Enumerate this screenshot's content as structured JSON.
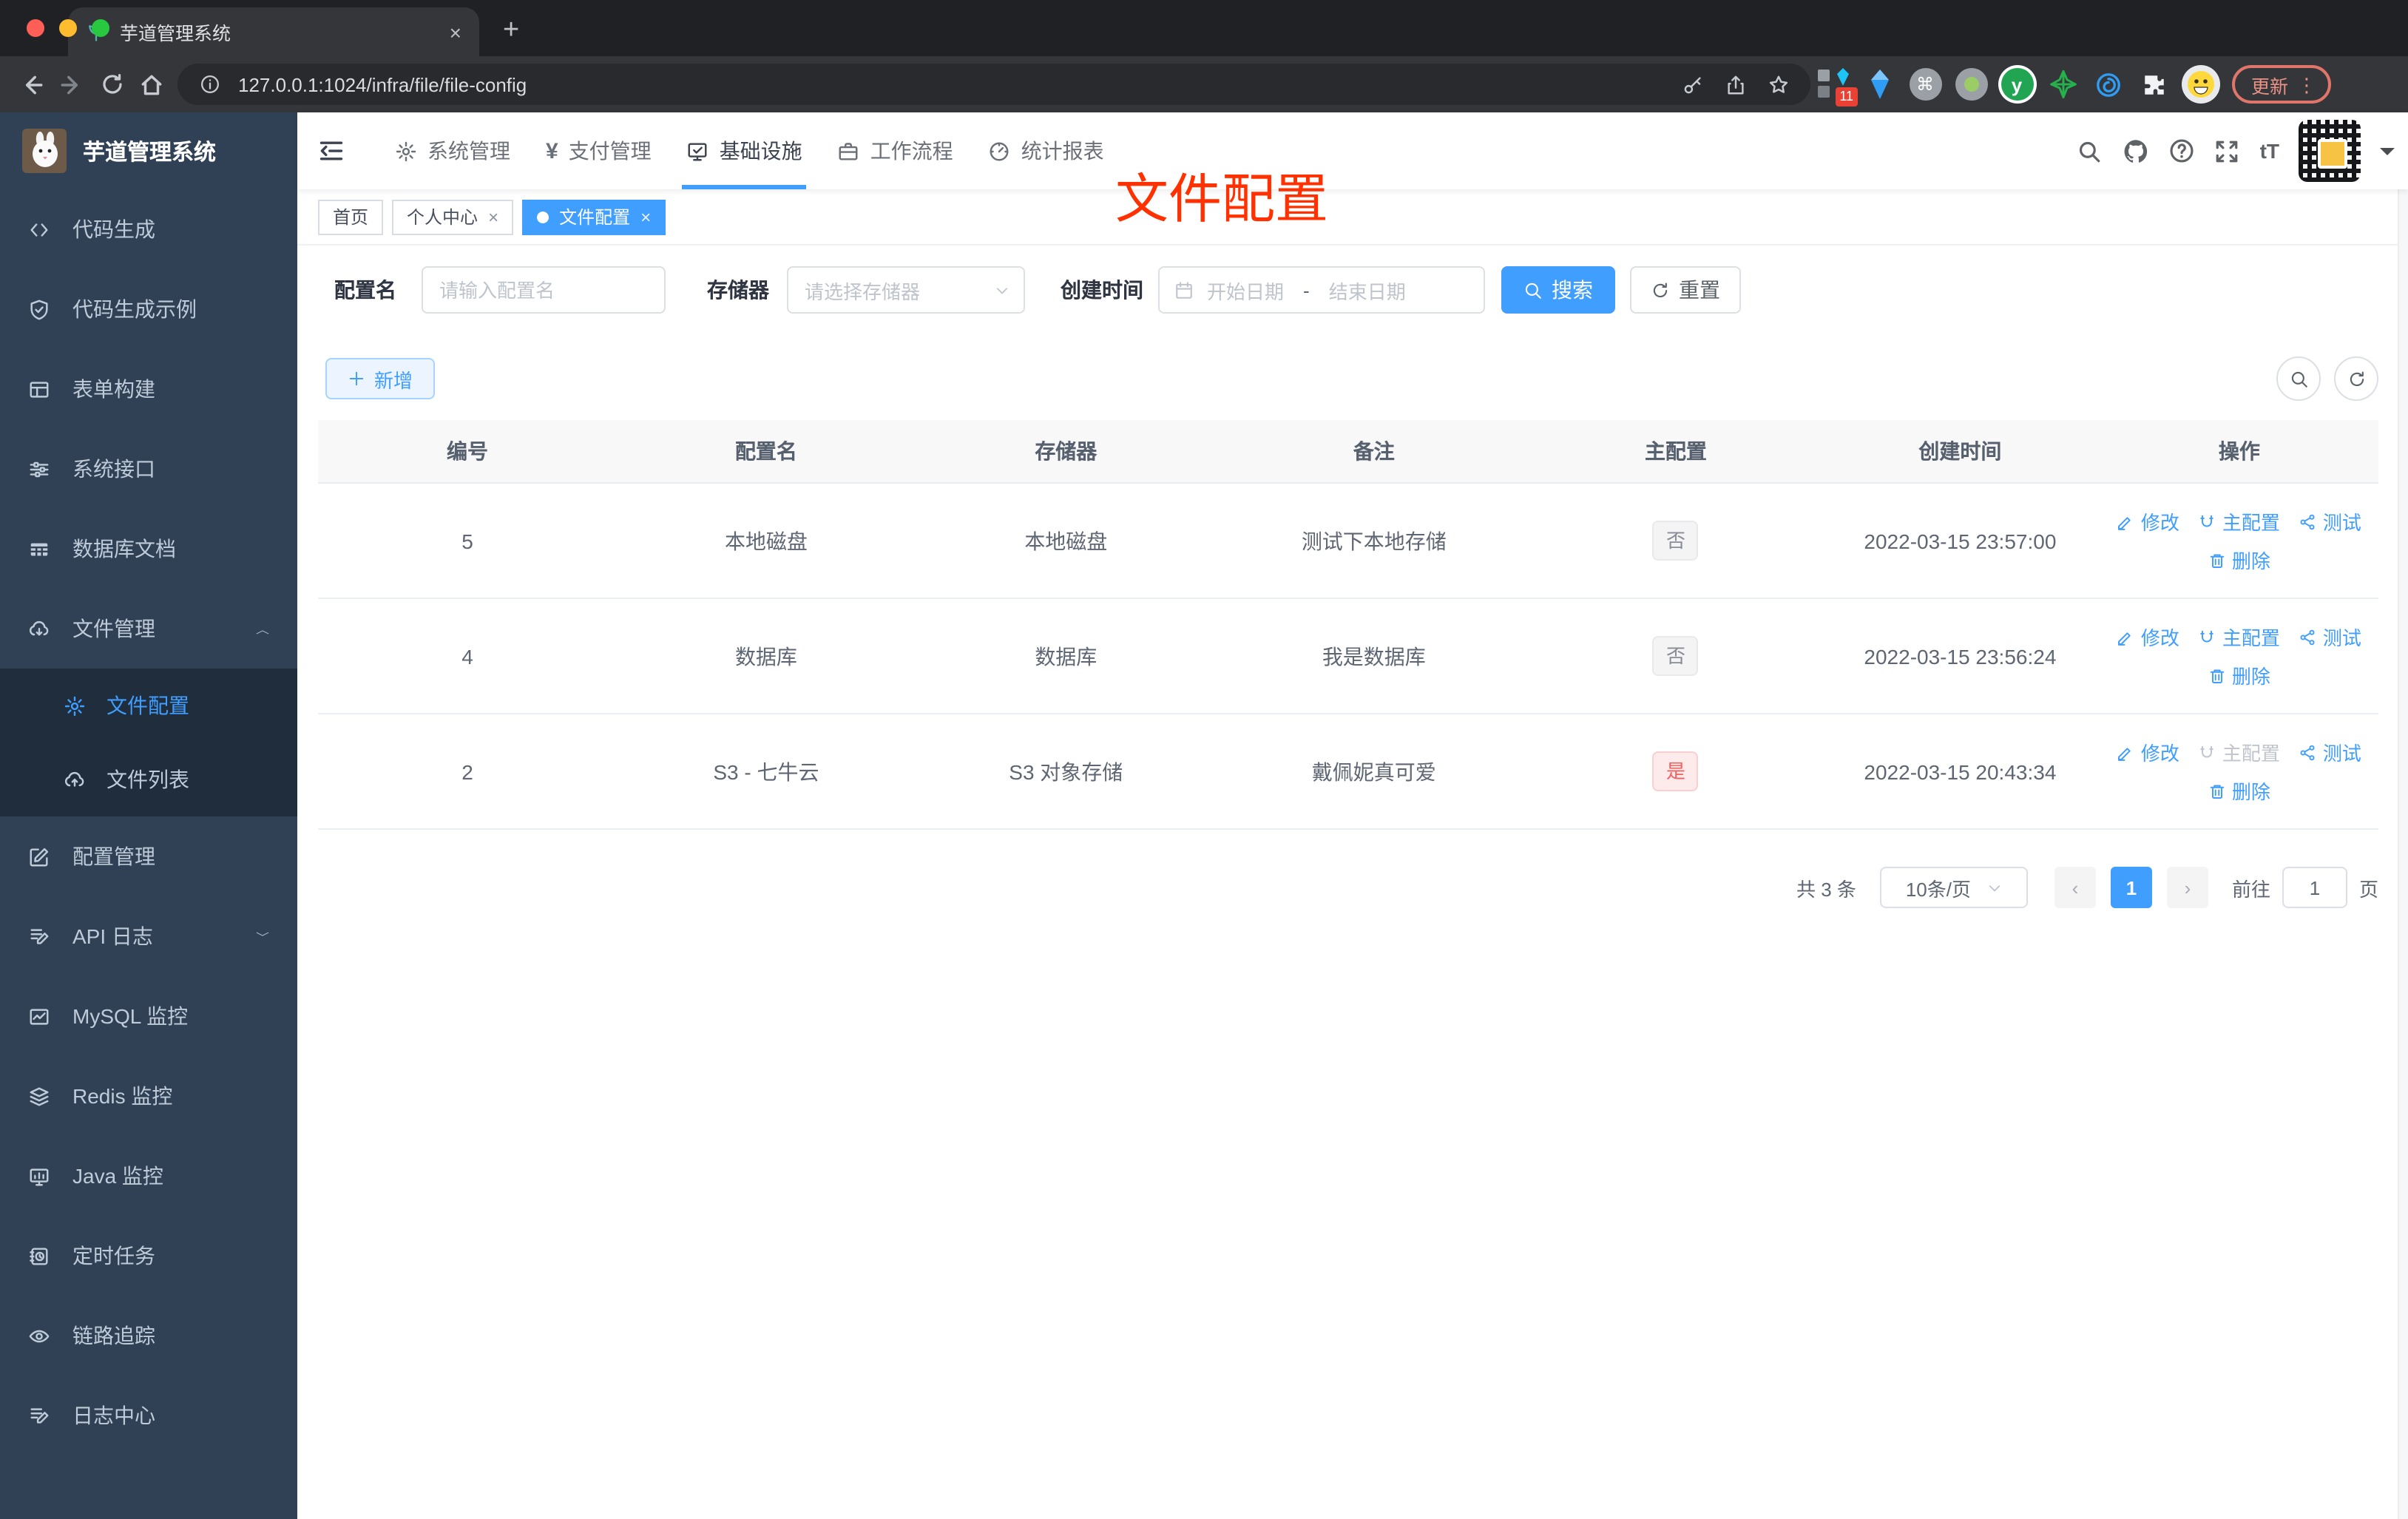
{
  "browser": {
    "tab_title": "芋道管理系统",
    "tab_close": "×",
    "new_tab": "+",
    "url": "127.0.0.1:1024/infra/file/file-config",
    "extension_badge": "11",
    "cmd_glyph": "⌘",
    "y_glyph": "y",
    "update_label": "更新",
    "menu_dots": "⋮"
  },
  "sidebar": {
    "title": "芋道管理系统",
    "items": [
      {
        "label": "代码生成"
      },
      {
        "label": "代码生成示例"
      },
      {
        "label": "表单构建"
      },
      {
        "label": "系统接口"
      },
      {
        "label": "数据库文档"
      },
      {
        "label": "文件管理"
      },
      {
        "label": "文件配置"
      },
      {
        "label": "文件列表"
      },
      {
        "label": "配置管理"
      },
      {
        "label": "API 日志"
      },
      {
        "label": "MySQL 监控"
      },
      {
        "label": "Redis 监控"
      },
      {
        "label": "Java 监控"
      },
      {
        "label": "定时任务"
      },
      {
        "label": "链路追踪"
      },
      {
        "label": "日志中心"
      }
    ]
  },
  "topnav": {
    "yen_glyph": "¥",
    "font_size_glyph": "tT",
    "items": [
      {
        "label": "系统管理"
      },
      {
        "label": "支付管理"
      },
      {
        "label": "基础设施"
      },
      {
        "label": "工作流程"
      },
      {
        "label": "统计报表"
      }
    ]
  },
  "tags": {
    "items": [
      {
        "label": "首页"
      },
      {
        "label": "个人中心"
      },
      {
        "label": "文件配置"
      }
    ],
    "close_glyph": "×"
  },
  "annotation": {
    "text": "文件配置"
  },
  "filters": {
    "config_name_label": "配置名",
    "config_name_placeholder": "请输入配置名",
    "storage_label": "存储器",
    "storage_placeholder": "请选择存储器",
    "create_time_label": "创建时间",
    "date_start_placeholder": "开始日期",
    "date_separator": "-",
    "date_end_placeholder": "结束日期",
    "search_label": "搜索",
    "reset_label": "重置"
  },
  "toolbar": {
    "add_label": "新增"
  },
  "table": {
    "columns": [
      "编号",
      "配置名",
      "存储器",
      "备注",
      "主配置",
      "创建时间",
      "操作"
    ],
    "actions": {
      "edit": "修改",
      "master": "主配置",
      "test": "测试",
      "delete": "删除"
    },
    "rows": [
      {
        "id": "5",
        "name": "本地磁盘",
        "storage": "本地磁盘",
        "remark": "测试下本地存储",
        "master": "否",
        "created": "2022-03-15 23:57:00"
      },
      {
        "id": "4",
        "name": "数据库",
        "storage": "数据库",
        "remark": "我是数据库",
        "master": "否",
        "created": "2022-03-15 23:56:24"
      },
      {
        "id": "2",
        "name": "S3 - 七牛云",
        "storage": "S3 对象存储",
        "remark": "戴佩妮真可爱",
        "master": "是",
        "created": "2022-03-15 20:43:34"
      }
    ]
  },
  "pagination": {
    "total": "共 3 条",
    "page_size": "10条/页",
    "prev_glyph": "‹",
    "next_glyph": "›",
    "current_page": "1",
    "goto_label": "前往",
    "goto_value": "1",
    "page_unit": "页"
  },
  "colors": {
    "accent": "#409eff",
    "annotation": "#ff3100",
    "sidebar": "#304156",
    "tag_yes": "#f25f5f"
  }
}
